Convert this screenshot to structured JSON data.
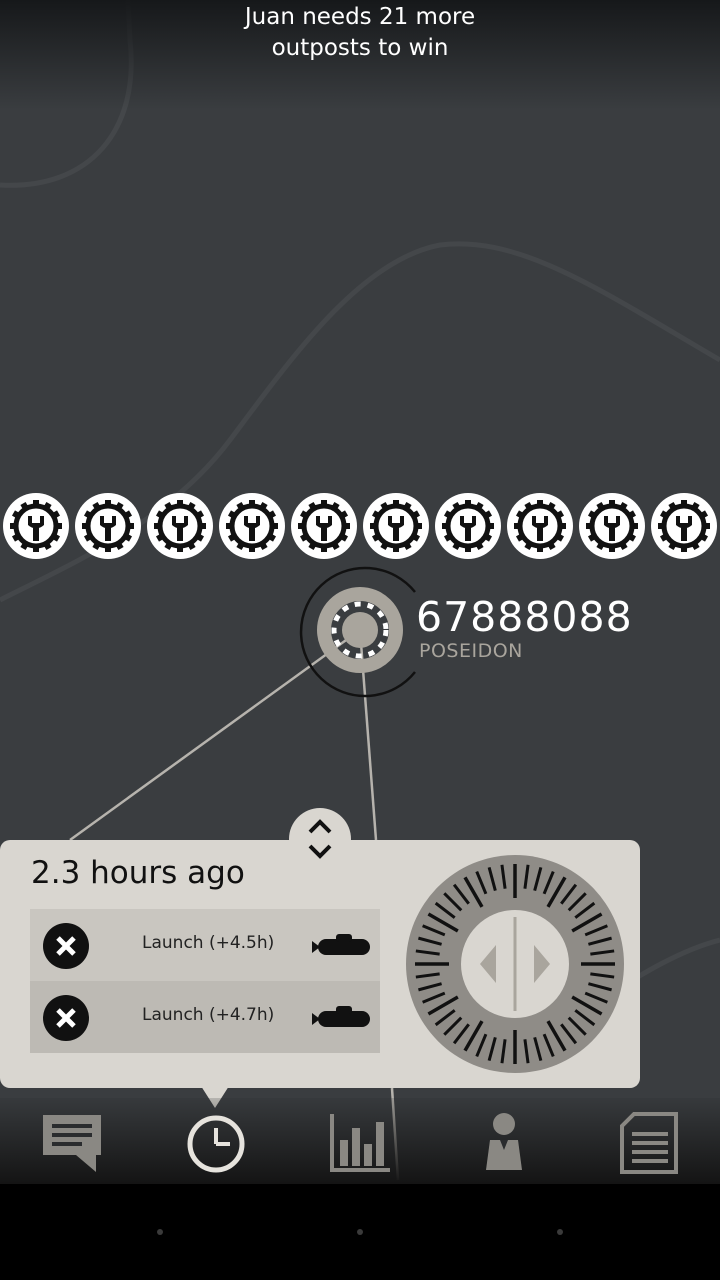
{
  "status": {
    "message_line1": "Juan needs 21 more",
    "message_line2": "outposts to win"
  },
  "outpost": {
    "number": "67888088",
    "owner": "POSEIDON"
  },
  "factories": {
    "count": 10,
    "icon": "factory-gear-icon"
  },
  "panel": {
    "time_label": "2.3 hours ago",
    "orders": [
      {
        "label": "Launch (+4.5h)",
        "icon": "submarine-icon"
      },
      {
        "label": "Launch (+4.7h)",
        "icon": "submarine-icon"
      }
    ]
  },
  "nav": [
    "chat-icon",
    "clock-icon",
    "stats-icon",
    "player-icon",
    "document-icon"
  ],
  "colors": {
    "background": "#3a3d40",
    "panel": "#d9d6d0",
    "text_light": "#ffffff",
    "owner": "#a9a59d"
  }
}
